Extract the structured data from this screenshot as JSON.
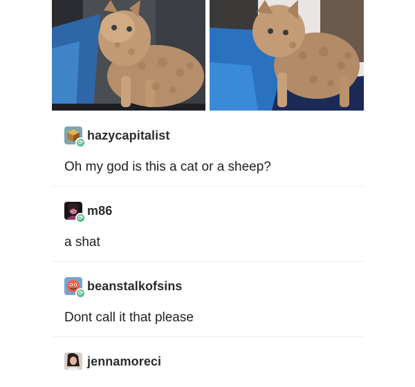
{
  "posts": [
    {
      "username": "hazycapitalist",
      "avatar_icon": "cube-avatar-icon",
      "text": "Oh my god is this a cat or a sheep?"
    },
    {
      "username": "m86",
      "avatar_icon": "portrait-avatar-icon",
      "text": "a shat"
    },
    {
      "username": "beanstalkofsins",
      "avatar_icon": "cartoon-avatar-icon",
      "text": "Dont call it that please"
    },
    {
      "username": "jennamoreci",
      "avatar_icon": "photo-avatar-icon",
      "text": ""
    }
  ],
  "colors": {
    "reblog_badge": "#56bc8a",
    "username": "#2b2b2b",
    "divider": "#efefef"
  },
  "icons": {
    "reblog_badge": "reblog-icon"
  }
}
